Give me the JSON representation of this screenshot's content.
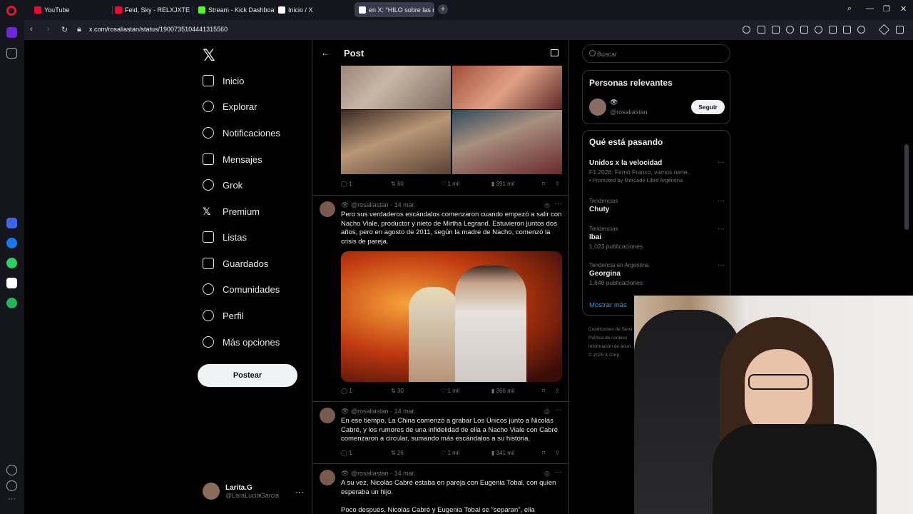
{
  "browser": {
    "tabs": [
      {
        "label": "YouTube",
        "icon": "youtube-icon"
      },
      {
        "label": "Feid, Sky - RELXJXTE - Yo",
        "icon": "youtube-icon"
      },
      {
        "label": "Stream - Kick Dashboard",
        "icon": "kick-icon"
      },
      {
        "label": "Inicio / X",
        "icon": "x-icon"
      },
      {
        "label": "en X: \"HILO sobre las n",
        "icon": "x-icon"
      }
    ],
    "url": "x.com/rosaliastan/status/1900735104441315560"
  },
  "nav": {
    "items": [
      {
        "label": "Inicio",
        "icon": "home-icon"
      },
      {
        "label": "Explorar",
        "icon": "search-icon"
      },
      {
        "label": "Notificaciones",
        "icon": "bell-icon"
      },
      {
        "label": "Mensajes",
        "icon": "mail-icon"
      },
      {
        "label": "Grok",
        "icon": "grok-icon"
      },
      {
        "label": "Premium",
        "icon": "x-icon"
      },
      {
        "label": "Listas",
        "icon": "list-icon"
      },
      {
        "label": "Guardados",
        "icon": "bookmark-icon"
      },
      {
        "label": "Comunidades",
        "icon": "people-icon"
      },
      {
        "label": "Perfil",
        "icon": "person-icon"
      },
      {
        "label": "Más opciones",
        "icon": "more-circle-icon"
      }
    ],
    "post_button": "Postear",
    "account": {
      "name": "Larita.G",
      "handle": "@LaraLuciaGarcia"
    }
  },
  "post": {
    "header_title": "Post",
    "gallery_stats": {
      "replies": "1",
      "retweets": "60",
      "likes": "1 mil",
      "views": "391 mil"
    },
    "tweets": [
      {
        "handle": "@rosaliastan",
        "date": "· 14 mar.",
        "text": "Pero sus verdaderos escándalos comenzaron cuando empezó a salir con Nacho Viale, productor y nieto de Mirtha Legrand. Estuvieron juntos dos años, pero en agosto de 2011, según la madre de Nacho, comenzó la crisis de pareja.",
        "replies": "1",
        "retweets": "30",
        "likes": "1 mil",
        "views": "366 mil"
      },
      {
        "handle": "@rosaliastan",
        "date": "· 14 mar.",
        "text": "En ese tiempo, La China comenzó a grabar Los Únicos junto a Nicolás Cabré, y los rumores de una infidelidad de ella a Nacho Viale con Cabré comenzaron a circular, sumando más escándalos a su historia.",
        "replies": "1",
        "retweets": "26",
        "likes": "1 mil",
        "views": "341 mil"
      },
      {
        "handle": "@rosaliastan",
        "date": "· 14 mar.",
        "text": "A su vez, Nicolás Cabré estaba en pareja con Eugenia Tobal, con quien esperaba un hijo.",
        "text2": "Poco después, Nicolás Cabré y Eugenia Tobal se \"separan\", ella"
      }
    ]
  },
  "right": {
    "search_placeholder": "Buscar",
    "relevant": {
      "title": "Personas relevantes",
      "name": "👁",
      "handle": "@rosaliastan",
      "follow_label": "Seguir"
    },
    "trends": {
      "title": "Qué está pasando",
      "items": [
        {
          "context": "",
          "name": "Unidos x la velocidad",
          "sub": "F1 2026: Firmó Franco, vamos nene.",
          "sub2": "Promoted by Mercado Libre Argentina"
        },
        {
          "context": "Tendencias",
          "name": "Chuty",
          "sub": ""
        },
        {
          "context": "Tendencias",
          "name": "Ibai",
          "sub": "1,023 publicaciones"
        },
        {
          "context": "Tendencia en Argentina",
          "name": "Georgina",
          "sub": "1,848 publicaciones"
        }
      ],
      "show_more": "Mostrar más"
    },
    "footer": [
      "Condiciones de Servi",
      "Política de cookies",
      "Información de anun",
      "© 2025 X Corp."
    ]
  }
}
